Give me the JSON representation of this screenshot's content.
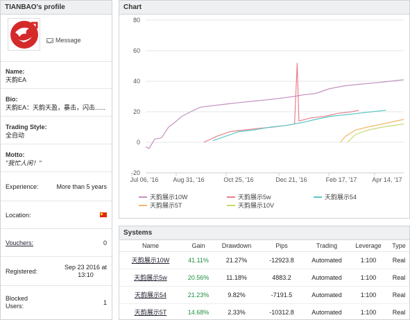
{
  "profile": {
    "title": "TIANBAO's profile",
    "message_label": "Message",
    "name_label": "Name:",
    "name_value": "天韵EA",
    "bio_label": "Bio:",
    "bio_value": "天韵EA：天韵天盈，暴击，闪击......",
    "style_label": "Trading Style:",
    "style_value": "全自动",
    "motto_label": "Motto:",
    "motto_value": "\"我忙人闲！\"",
    "experience_label": "Experience:",
    "experience_value": "More than 5 years",
    "location_label": "Location:",
    "vouchers_label": "Vouchers:",
    "vouchers_value": "0",
    "registered_label": "Registered:",
    "registered_value_1": "Sep 23 2016 at",
    "registered_value_2": "13:10",
    "blocked_label_1": "Blocked",
    "blocked_label_2": "Users:",
    "blocked_value": "1",
    "colors": {
      "flag": "#de2910",
      "avatar": "#d42a2a"
    }
  },
  "chart": {
    "panel_title": "Chart",
    "chart_data": {
      "type": "line",
      "x_ticks": [
        "Jul 06, '16",
        "Aug 31, '16",
        "Oct 25, '16",
        "Dec 21, '16",
        "Feb 17, '17",
        "Apr 14, '17"
      ],
      "y_ticks": [
        "80",
        "60",
        "40",
        "20",
        "0",
        "-20"
      ],
      "ylim": [
        -20,
        80
      ],
      "xlim": [
        "2016-07-06",
        "2017-04-25"
      ],
      "grid": true,
      "legend_position": "bottom",
      "series": [
        {
          "name": "天韵展示10W",
          "color": "#c490c0",
          "points": [
            [
              "2016-07-06",
              -3
            ],
            [
              "2016-07-10",
              -4
            ],
            [
              "2016-07-16",
              2
            ],
            [
              "2016-07-24",
              3
            ],
            [
              "2016-08-01",
              10
            ],
            [
              "2016-08-08",
              13
            ],
            [
              "2016-08-16",
              17
            ],
            [
              "2016-08-26",
              20
            ],
            [
              "2016-09-06",
              23
            ],
            [
              "2016-09-20",
              24
            ],
            [
              "2016-10-05",
              25
            ],
            [
              "2016-10-20",
              26
            ],
            [
              "2016-11-06",
              27
            ],
            [
              "2016-11-24",
              28
            ],
            [
              "2016-12-08",
              29
            ],
            [
              "2016-12-21",
              30
            ],
            [
              "2016-12-31",
              31
            ],
            [
              "2017-01-15",
              32
            ],
            [
              "2017-01-30",
              35
            ],
            [
              "2017-02-17",
              37
            ],
            [
              "2017-03-06",
              38
            ],
            [
              "2017-03-25",
              39
            ],
            [
              "2017-04-10",
              40
            ],
            [
              "2017-04-25",
              41
            ]
          ]
        },
        {
          "name": "天韵展示5w",
          "color": "#e8808a",
          "points": [
            [
              "2016-09-10",
              0
            ],
            [
              "2016-09-25",
              4
            ],
            [
              "2016-10-10",
              7
            ],
            [
              "2016-10-25",
              8
            ],
            [
              "2016-11-10",
              9
            ],
            [
              "2016-11-28",
              10
            ],
            [
              "2016-12-12",
              11
            ],
            [
              "2016-12-22",
              12
            ],
            [
              "2016-12-25",
              52
            ],
            [
              "2016-12-27",
              14
            ],
            [
              "2017-01-10",
              16
            ],
            [
              "2017-01-25",
              17
            ],
            [
              "2017-02-10",
              19
            ],
            [
              "2017-02-25",
              20
            ],
            [
              "2017-03-05",
              21
            ]
          ]
        },
        {
          "name": "天韵展示54",
          "color": "#5ac8c8",
          "points": [
            [
              "2016-09-20",
              1
            ],
            [
              "2016-10-05",
              4
            ],
            [
              "2016-10-20",
              7
            ],
            [
              "2016-11-05",
              8
            ],
            [
              "2016-11-25",
              10
            ],
            [
              "2016-12-12",
              11
            ],
            [
              "2016-12-31",
              13
            ],
            [
              "2017-01-15",
              15
            ],
            [
              "2017-02-01",
              17
            ],
            [
              "2017-02-17",
              18
            ],
            [
              "2017-03-05",
              19
            ],
            [
              "2017-03-20",
              20
            ],
            [
              "2017-04-05",
              21
            ]
          ]
        },
        {
          "name": "天韵展示5T",
          "color": "#f0b860",
          "points": [
            [
              "2017-02-12",
              0
            ],
            [
              "2017-02-18",
              4
            ],
            [
              "2017-03-01",
              8
            ],
            [
              "2017-03-15",
              10
            ],
            [
              "2017-04-01",
              12
            ],
            [
              "2017-04-25",
              15
            ]
          ]
        },
        {
          "name": "天韵展示10V",
          "color": "#c8d870",
          "points": [
            [
              "2017-02-20",
              0
            ],
            [
              "2017-03-01",
              5
            ],
            [
              "2017-03-15",
              8
            ],
            [
              "2017-04-01",
              10
            ],
            [
              "2017-04-25",
              12
            ]
          ]
        }
      ]
    }
  },
  "systems": {
    "title": "Systems",
    "columns": [
      "Name",
      "Gain",
      "Drawdown",
      "Pips",
      "Trading",
      "Leverage",
      "Type"
    ],
    "rows": [
      {
        "name": "天韵展示10W",
        "gain": "41.11%",
        "drawdown": "21.27%",
        "pips": "-12923.8",
        "trading": "Automated",
        "leverage": "1:100",
        "type": "Real"
      },
      {
        "name": "天韵展示5w",
        "gain": "20.56%",
        "drawdown": "11.18%",
        "pips": "4883.2",
        "trading": "Automated",
        "leverage": "1:100",
        "type": "Real"
      },
      {
        "name": "天韵展示54",
        "gain": "21.23%",
        "drawdown": "9.82%",
        "pips": "-7191.5",
        "trading": "Automated",
        "leverage": "1:100",
        "type": "Real"
      },
      {
        "name": "天韵展示5T",
        "gain": "14.68%",
        "drawdown": "2.33%",
        "pips": "-10312.8",
        "trading": "Automated",
        "leverage": "1:100",
        "type": "Real"
      }
    ]
  }
}
